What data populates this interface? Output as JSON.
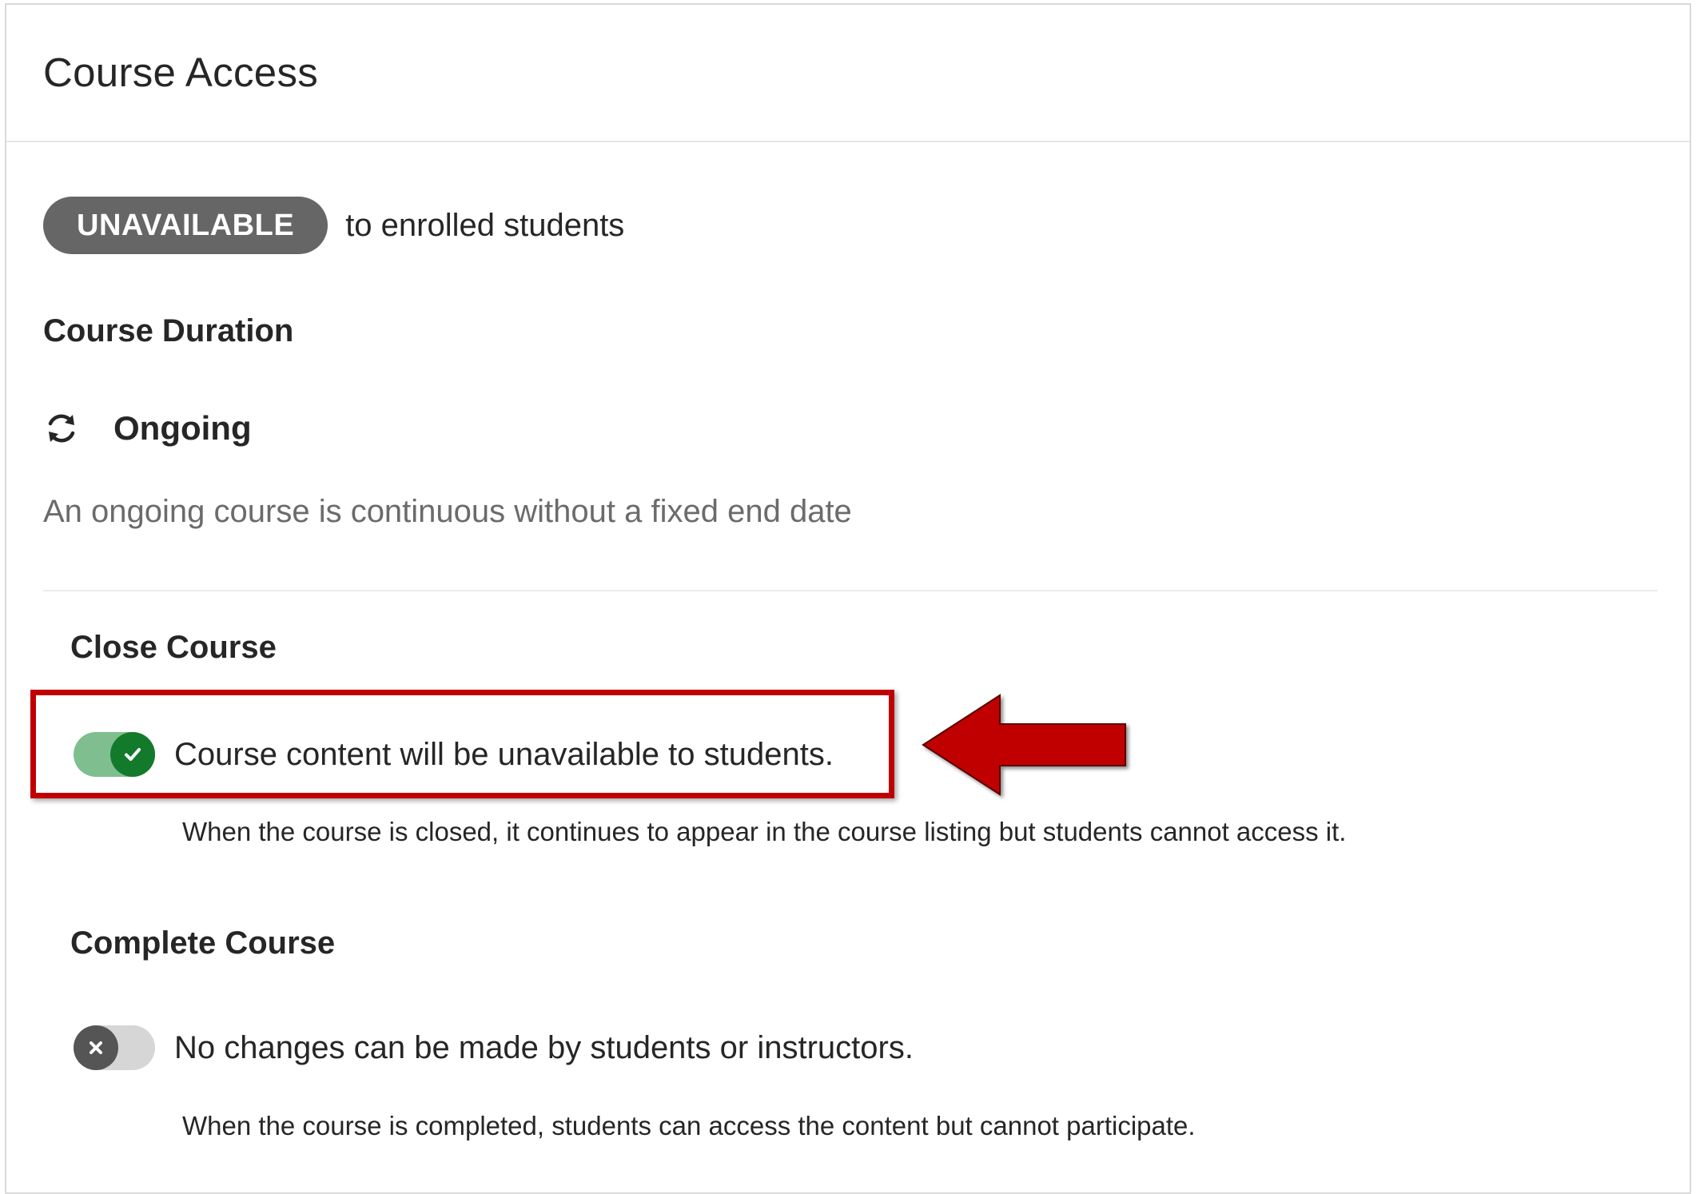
{
  "panel": {
    "title": "Course Access"
  },
  "status": {
    "badge": "UNAVAILABLE",
    "text": "to enrolled students",
    "badge_color": "#666666"
  },
  "duration": {
    "heading": "Course Duration",
    "icon": "refresh-icon",
    "value": "Ongoing",
    "description": "An ongoing course is continuous without a fixed end date"
  },
  "close_course": {
    "heading": "Close Course",
    "toggle_on": true,
    "label": "Course content will be unavailable to students.",
    "help": "When the course is closed, it continues to appear in the course listing but students cannot access it.",
    "accent_color": "#137a2c"
  },
  "complete_course": {
    "heading": "Complete Course",
    "toggle_on": false,
    "label": "No changes can be made by students or instructors.",
    "help": "When the course is completed, students can access the content but cannot participate."
  },
  "annotation": {
    "highlight_color": "#c00000",
    "arrow_icon": "arrow-left-icon"
  }
}
